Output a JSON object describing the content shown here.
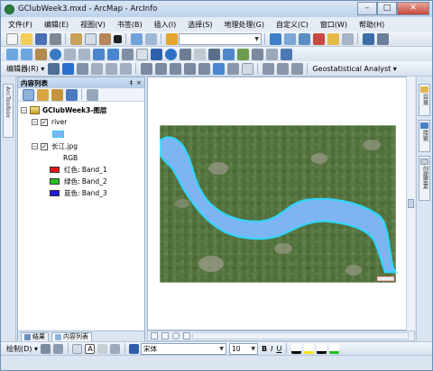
{
  "window": {
    "title": "GClubWeek3.mxd - ArcMap - ArcInfo",
    "minimize": "–",
    "maximize": "□",
    "close": "✕"
  },
  "menu": [
    "文件(F)",
    "编辑(E)",
    "视图(V)",
    "书签(B)",
    "插入(I)",
    "选择(S)",
    "地理处理(G)",
    "自定义(C)",
    "窗口(W)",
    "帮助(H)"
  ],
  "toolbar": {
    "scale_value": "",
    "editor_label": "编辑器(R) ▾",
    "geostatistical_label": "Geostatistical Analyst ▾"
  },
  "left_strip": {
    "arctoolbox_label": "ArcToolbox"
  },
  "toc": {
    "title": "内容列表",
    "pin": "‡",
    "close": "×",
    "dataframe": "GClubWeek3-图层",
    "layer1": "river",
    "layer2": "长江.jpg",
    "rgb_label": "RGB",
    "bands": [
      {
        "label": "红色:   Band_1",
        "color": "#e8141b"
      },
      {
        "label": "绿色:   Band_2",
        "color": "#22c322"
      },
      {
        "label": "蓝色:   Band_3",
        "color": "#1c1ce0"
      }
    ],
    "tab_results": "结果",
    "tab_toc": "内容列表"
  },
  "right_strip": {
    "tab1": "目录",
    "tab2": "搜索",
    "tab3": "创建要素"
  },
  "draw_toolbar": {
    "draw_label": "绘制(D) ▾",
    "font_name": "宋体",
    "font_size": "10",
    "bold": "B",
    "italic": "I",
    "underline": "U",
    "text_tool": "A"
  },
  "colors": {
    "river": "#7fb4f2",
    "river_outline": "#2fd6ff",
    "frame_bg": "#ffffff"
  }
}
